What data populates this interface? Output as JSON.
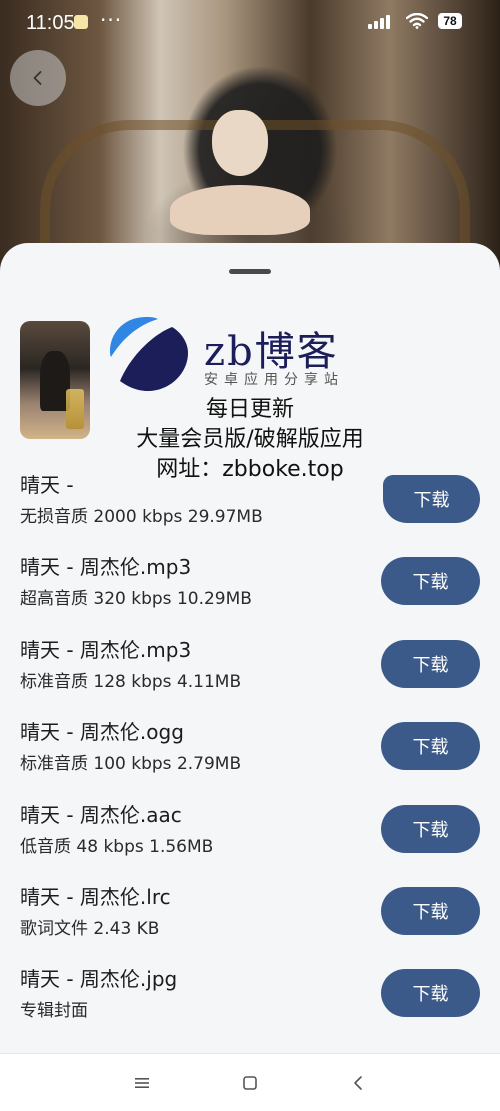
{
  "status_bar": {
    "time": "11:05",
    "dots": "···",
    "battery": "78"
  },
  "ad": {
    "brand": "zb博客",
    "brand_sub": "安卓应用分享站",
    "line1": "每日更新",
    "line2": "大量会员版/破解版应用",
    "line3": "网址：zbboke.top"
  },
  "download_label": "下载",
  "files": [
    {
      "name": "晴天 - ",
      "meta": "无损音质 2000 kbps 29.97MB"
    },
    {
      "name": "晴天 - 周杰伦.mp3",
      "meta": "超高音质 320 kbps 10.29MB"
    },
    {
      "name": "晴天 - 周杰伦.mp3",
      "meta": "标准音质 128 kbps 4.11MB"
    },
    {
      "name": "晴天 - 周杰伦.ogg",
      "meta": "标准音质 100 kbps 2.79MB"
    },
    {
      "name": "晴天 - 周杰伦.aac",
      "meta": "低音质 48 kbps 1.56MB"
    },
    {
      "name": "晴天 - 周杰伦.lrc",
      "meta": "歌词文件  2.43 KB"
    },
    {
      "name": "晴天 - 周杰伦.jpg",
      "meta": "专辑封面"
    }
  ],
  "colors": {
    "button": "#3c5a89",
    "sheet": "#f5f6f8",
    "brand": "#1c1e5a"
  },
  "icons": {
    "back": "chevron-left-icon",
    "nav_menu": "menu-icon",
    "nav_home": "square-icon",
    "nav_back": "triangle-back-icon"
  }
}
